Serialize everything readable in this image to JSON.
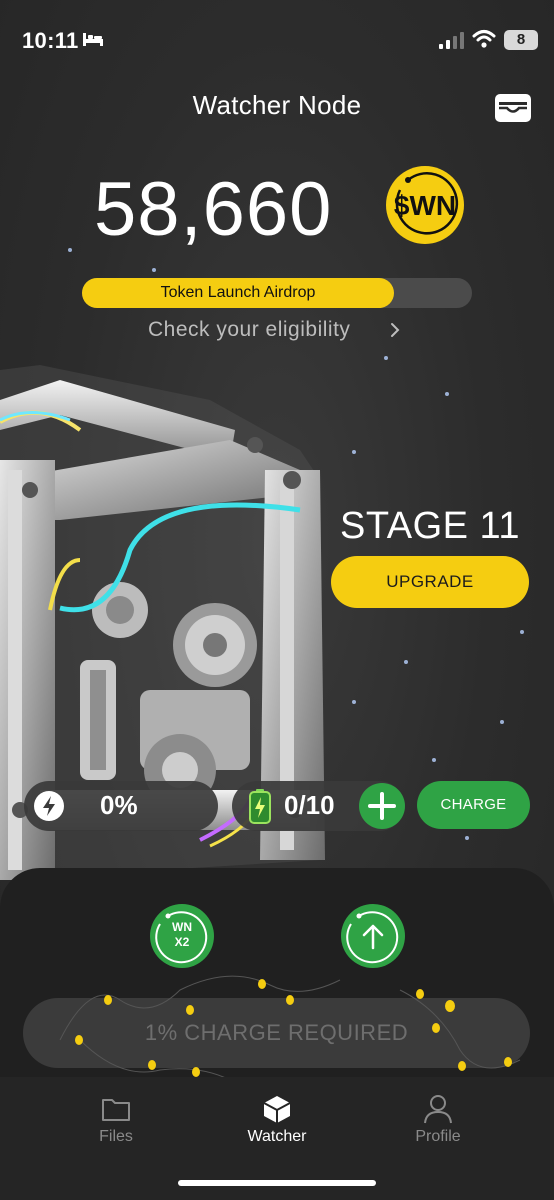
{
  "status_bar": {
    "time": "10:11",
    "battery_level": "8"
  },
  "header": {
    "title": "Watcher Node"
  },
  "balance": {
    "amount": "58,660",
    "token_symbol": "$WN"
  },
  "airdrop": {
    "label": "Token Launch Airdrop",
    "progress": 0.8,
    "link_text": "Check your eligibility"
  },
  "stage": {
    "title": "STAGE 11",
    "upgrade_label": "UPGRADE"
  },
  "energy": {
    "value": "0%"
  },
  "charges": {
    "value": "0/10",
    "charge_label": "CHARGE"
  },
  "boost": {
    "label_line1": "WN",
    "label_line2": "X2"
  },
  "action": {
    "label": "1% CHARGE REQUIRED"
  },
  "tabs": [
    {
      "label": "Files",
      "icon": "folder-icon"
    },
    {
      "label": "Watcher",
      "icon": "cube-icon"
    },
    {
      "label": "Profile",
      "icon": "person-icon"
    }
  ],
  "colors": {
    "accent_yellow": "#f5cd11",
    "accent_green": "#2fa345",
    "background": "#2b2b2b"
  }
}
